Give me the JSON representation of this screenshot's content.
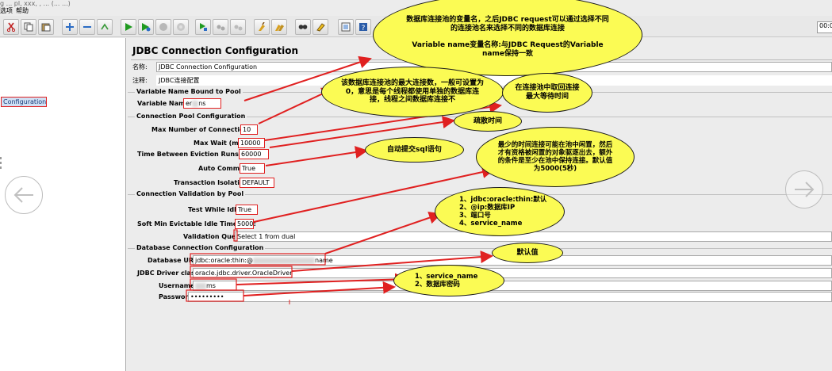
{
  "top_clip_text": "g ... pl, xxx, , ... (... ...)",
  "menu": {
    "item1": "选项",
    "item2": "帮助"
  },
  "timer": "00:0",
  "tree": {
    "selected_item": "Configuration"
  },
  "panel": {
    "title": "JDBC Connection Configuration",
    "name_label": "名称:",
    "name_value": "JDBC Connection Configuration",
    "comment_label": "注释:",
    "comment_value": "JDBC连接配置",
    "variable_group": "Variable Name Bound to Pool",
    "variable_name_label": "Variable Name:",
    "variable_name_value_prefix": "er",
    "variable_name_value_suffix": "ns",
    "pool_group": "Connection Pool Configuration",
    "max_connections_label": "Max Number of Connections:",
    "max_connections_value": "10",
    "max_wait_label": "Max Wait (ms):",
    "max_wait_value": "10000",
    "eviction_label": "Time Between Eviction Runs (ms):",
    "eviction_value": "60000",
    "auto_commit_label": "Auto Commit:",
    "auto_commit_value": "True",
    "isolation_label": "Transaction Isolation:",
    "isolation_value": "DEFAULT",
    "validation_group": "Connection Validation by Pool",
    "test_idle_label": "Test While Idle:",
    "test_idle_value": "True",
    "soft_min_label": "Soft Min Evictable Idle Time(ms):",
    "soft_min_value": "5000",
    "validation_query_label": "Validation Query:",
    "validation_query_value": "Select 1 from dual",
    "db_group": "Database Connection Configuration",
    "db_url_label": "Database URL:",
    "db_url_value_prefix": "jdbc:oracle:thin:@",
    "db_url_value_suffix": "name",
    "driver_label": "JDBC Driver class:",
    "driver_value": "oracle.jdbc.driver.OracleDriver",
    "username_label": "Username:",
    "username_value": "ms",
    "password_label": "Password:",
    "password_value": "•••••••••"
  },
  "annotations": {
    "variable_note": "数据库连接池的变量名，之后JDBC request可以通过选择不同的连接池名来选择不同的数据库连接\n\nVariable name变量名称:与JDBC Request的Variable name保持一致",
    "max_conn_note": "该数据库连接池的最大连接数，一般可设置为0，意思是每个线程都使用单独的数据库连接，线程之间数据库连接不",
    "max_wait_note": "在连接池中取回连接最大等待时间",
    "eviction_note": "疏散时间",
    "auto_commit_note": "自动提交sql语句",
    "soft_min_note": "最少的时间连接可能在池中闲置，然后才有资格被闲置的对象驱逐出去，额外的条件是至少在池中保持连接。默认值为5000(5秒)",
    "url_note": "1、jdbc:oracle:thin:默认\n2、@ip:数据库IP\n3、端口号\n4、service_name",
    "driver_note": "默认值",
    "credentials_note": "1、service_name\n2、数据库密码"
  },
  "colors": {
    "bubble": "#fbfb54",
    "arrow": "#e02020",
    "selection": "#cfe0f4"
  },
  "icons": [
    "cut-icon",
    "copy-icon",
    "paste-icon",
    "expand-icon",
    "collapse-icon",
    "toggle-icon",
    "start-icon",
    "start-no-pause-icon",
    "stop-icon",
    "shutdown-icon",
    "remote-start-icon",
    "remote-stop-icon",
    "remote-shutdown-icon",
    "clear-icon",
    "clear-all-icon",
    "search-icon",
    "reset-search-icon",
    "function-helper-icon",
    "help-icon"
  ]
}
